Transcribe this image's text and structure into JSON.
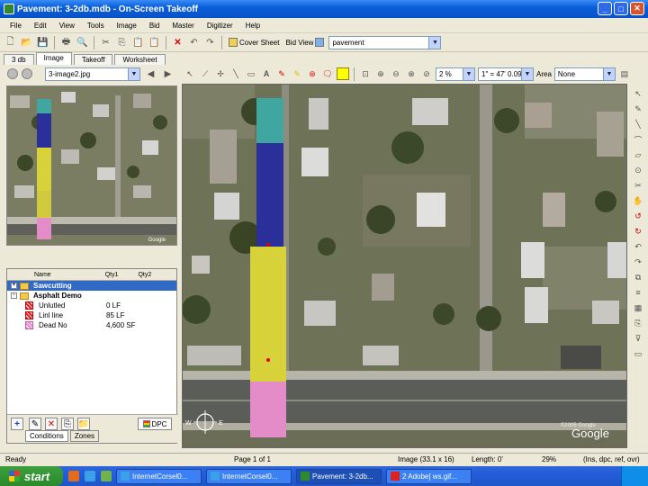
{
  "window": {
    "title": "Pavement: 3-2db.mdb - On-Screen Takeoff",
    "minimize": "_",
    "maximize": "□",
    "close": "✕"
  },
  "menu": [
    "File",
    "Edit",
    "View",
    "Tools",
    "Image",
    "Bid",
    "Master",
    "Digitizer",
    "Help"
  ],
  "toolbar": {
    "cover_sheet": "Cover Sheet",
    "bid_view": "Bid View",
    "bid_combo_value": "pavement"
  },
  "tabs": [
    "3 db",
    "Image",
    "Takeoff",
    "Worksheet"
  ],
  "left_panel": {
    "image_combo": "3-image2.jpg"
  },
  "map_toolbar": {
    "zoom_combo": "2 %",
    "scale_combo": "1\" = 47' 0.094\"",
    "area_label": "Area",
    "area_combo": "None"
  },
  "conditions": {
    "headers": [
      "Name",
      "Qty1",
      "Qty2"
    ],
    "rows": [
      {
        "name": "Sawcutting",
        "qty": "",
        "level": 0,
        "type": "folder",
        "expand": "+"
      },
      {
        "name": "Asphalt Demo",
        "qty": "",
        "level": 0,
        "type": "folder",
        "expand": "-"
      },
      {
        "name": "Unlutled",
        "qty": "0 LF",
        "level": 1,
        "type": "hatch-red"
      },
      {
        "name": "Linl line",
        "qty": "85 LF",
        "level": 1,
        "type": "hatch-red"
      },
      {
        "name": "Dead No",
        "qty": "4,600 SF",
        "level": 1,
        "type": "hatch-pink"
      }
    ],
    "dpc_label": "DPC",
    "bottom_tabs": [
      "Conditions",
      "Zones"
    ]
  },
  "map": {
    "watermark": "©2005 Google",
    "google_logo": "Google",
    "compass_w": "W",
    "compass_e": "E",
    "overlay_colors": {
      "teal": "#3fa7a0",
      "blue": "#2a2f9a",
      "yellow": "#d8d23a",
      "pink": "#e48cc8"
    }
  },
  "thumbnail": {
    "google_label": "Google"
  },
  "statusbar": {
    "ready": "Ready",
    "page": "Page 1 of 1",
    "image": "Image (33.1 x 16)",
    "length": "Length: 0'",
    "zoom": "29%",
    "mode": "(Ins, dpc, ref, ovr)"
  },
  "taskbar": {
    "start": "start",
    "items": [
      "InternetCorsel0...",
      "InternetCorsel0...",
      "Pavement: 3-2db...",
      "2 Adobe] ws.gif..."
    ]
  }
}
